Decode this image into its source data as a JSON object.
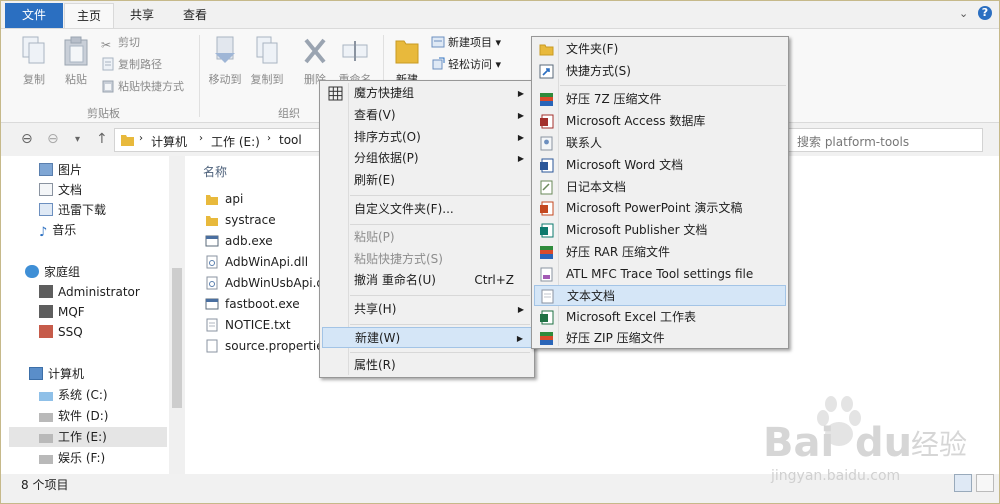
{
  "tabs": {
    "file": "文件",
    "home": "主页",
    "share": "共享",
    "view": "查看"
  },
  "window_controls": {
    "help": "?",
    "expand": "⌄"
  },
  "ribbon": {
    "copy": "复制",
    "paste": "粘贴",
    "cut": "剪切",
    "copy_path": "复制路径",
    "paste_shortcut": "粘贴快捷方式",
    "clipboard_group": "剪贴板",
    "move_to": "移动到",
    "copy_to": "复制到",
    "delete": "删除",
    "rename": "重命名",
    "organize_group": "组织",
    "new_folder": "新建",
    "new_item": "新建项目",
    "easy_access": "轻松访问"
  },
  "address": {
    "crumbs": [
      "计算机",
      "工作 (E:)",
      "tool"
    ],
    "search_placeholder": "搜索 platform-tools"
  },
  "nav_items": [
    {
      "label": "图片",
      "icon": "pictures-icon"
    },
    {
      "label": "文档",
      "icon": "documents-icon"
    },
    {
      "label": "迅雷下载",
      "icon": "downloads-icon"
    },
    {
      "label": "音乐",
      "icon": "music-icon"
    },
    {
      "label": "家庭组",
      "icon": "homegroup-icon"
    },
    {
      "label": "Administrator",
      "icon": "user-icon"
    },
    {
      "label": "MQF",
      "icon": "user-icon"
    },
    {
      "label": "SSQ",
      "icon": "user-icon"
    },
    {
      "label": "计算机",
      "icon": "computer-icon"
    },
    {
      "label": "系统 (C:)",
      "icon": "drive-icon"
    },
    {
      "label": "软件 (D:)",
      "icon": "drive-icon"
    },
    {
      "label": "工作 (E:)",
      "icon": "drive-icon"
    },
    {
      "label": "娱乐 (F:)",
      "icon": "drive-icon"
    }
  ],
  "file_header": "名称",
  "files": [
    {
      "name": "api",
      "icon": "folder-icon"
    },
    {
      "name": "systrace",
      "icon": "folder-icon"
    },
    {
      "name": "adb.exe",
      "icon": "exe-icon"
    },
    {
      "name": "AdbWinApi.dll",
      "icon": "dll-icon"
    },
    {
      "name": "AdbWinUsbApi.d",
      "icon": "dll-icon"
    },
    {
      "name": "fastboot.exe",
      "icon": "exe-icon"
    },
    {
      "name": "NOTICE.txt",
      "icon": "text-file-icon"
    },
    {
      "name": "source.propertie",
      "icon": "file-icon"
    }
  ],
  "status": "8 个项目",
  "context_menu": [
    {
      "label": "魔方快捷组",
      "arrow": "▶"
    },
    {
      "label": "查看(V)",
      "arrow": "▶"
    },
    {
      "label": "排序方式(O)",
      "arrow": "▶"
    },
    {
      "label": "分组依据(P)",
      "arrow": "▶"
    },
    {
      "label": "刷新(E)"
    },
    {
      "label": "自定义文件夹(F)..."
    },
    {
      "label": "粘贴(P)"
    },
    {
      "label": "粘贴快捷方式(S)"
    },
    {
      "label": "撤消 重命名(U)",
      "shortcut": "Ctrl+Z"
    },
    {
      "label": "共享(H)",
      "arrow": "▶"
    },
    {
      "label": "新建(W)",
      "arrow": "▶"
    },
    {
      "label": "属性(R)"
    }
  ],
  "new_submenu": [
    {
      "label": "文件夹(F)",
      "icon": "folder-icon"
    },
    {
      "label": "快捷方式(S)",
      "icon": "shortcut-icon"
    },
    {
      "label": "好压 7Z 压缩文件",
      "icon": "archive-icon"
    },
    {
      "label": "Microsoft Access 数据库",
      "icon": "access-icon"
    },
    {
      "label": "联系人",
      "icon": "contact-icon"
    },
    {
      "label": "Microsoft Word 文档",
      "icon": "word-icon"
    },
    {
      "label": "日记本文档",
      "icon": "journal-icon"
    },
    {
      "label": "Microsoft PowerPoint 演示文稿",
      "icon": "powerpoint-icon"
    },
    {
      "label": "Microsoft Publisher 文档",
      "icon": "publisher-icon"
    },
    {
      "label": "好压 RAR 压缩文件",
      "icon": "archive-icon"
    },
    {
      "label": "ATL MFC Trace Tool settings file",
      "icon": "settings-file-icon"
    },
    {
      "label": "文本文档",
      "icon": "text-file-icon"
    },
    {
      "label": "Microsoft Excel 工作表",
      "icon": "excel-icon"
    },
    {
      "label": "好压 ZIP 压缩文件",
      "icon": "archive-icon"
    }
  ],
  "watermark": {
    "brand": "Bai",
    "brand2": "du",
    "cn": "经验",
    "url": "jingyan.baidu.com"
  },
  "colors": {
    "accent": "#2b6fc1",
    "highlight": "#d5e6f7",
    "folder": "#e8b93c"
  }
}
